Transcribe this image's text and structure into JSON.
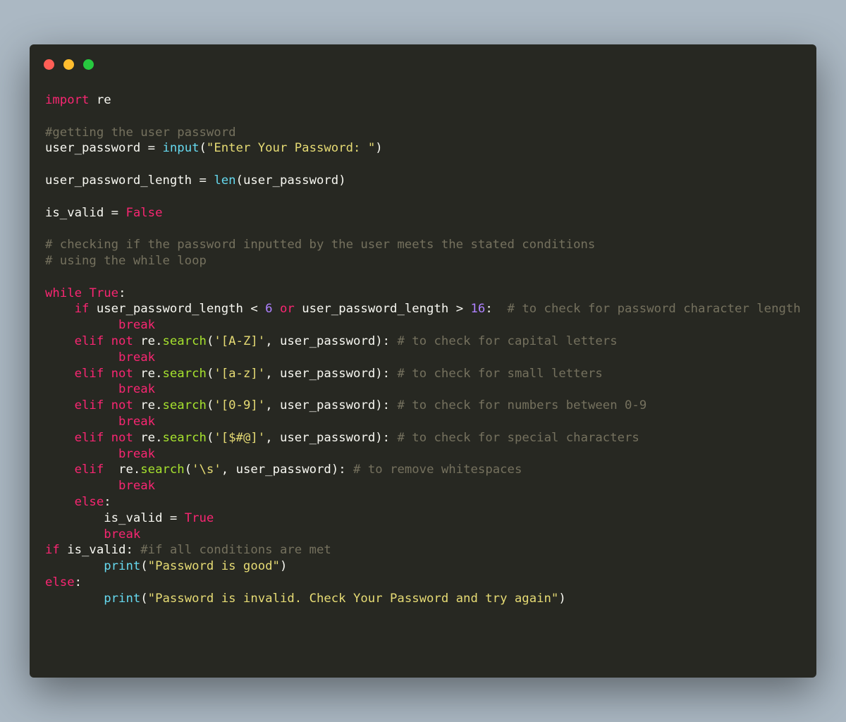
{
  "window": {
    "controls": [
      "close",
      "minimize",
      "maximize"
    ]
  },
  "colors": {
    "background": "#abb8c3",
    "editor": "#272822",
    "keyword": "#f92672",
    "builtin": "#66d9ef",
    "method": "#a6e22e",
    "string": "#e6db74",
    "number": "#ae81ff",
    "comment": "#75715e",
    "text": "#f8f8f2"
  },
  "code": {
    "lines": [
      [
        [
          "kw",
          "import"
        ],
        [
          "ws",
          " "
        ],
        [
          "id",
          "re"
        ]
      ],
      [],
      [
        [
          "cm",
          "#getting the user password"
        ]
      ],
      [
        [
          "id",
          "user_password"
        ],
        [
          "ws",
          " "
        ],
        [
          "op",
          "="
        ],
        [
          "ws",
          " "
        ],
        [
          "fn",
          "input"
        ],
        [
          "op",
          "("
        ],
        [
          "str",
          "\"Enter Your Password: \""
        ],
        [
          "op",
          ")"
        ]
      ],
      [],
      [
        [
          "id",
          "user_password_length"
        ],
        [
          "ws",
          " "
        ],
        [
          "op",
          "="
        ],
        [
          "ws",
          " "
        ],
        [
          "fn",
          "len"
        ],
        [
          "op",
          "("
        ],
        [
          "id",
          "user_password"
        ],
        [
          "op",
          ")"
        ]
      ],
      [],
      [
        [
          "id",
          "is_valid"
        ],
        [
          "ws",
          " "
        ],
        [
          "op",
          "="
        ],
        [
          "ws",
          " "
        ],
        [
          "kw",
          "False"
        ]
      ],
      [],
      [
        [
          "cm",
          "# checking if the password inputted by the user meets the stated conditions"
        ]
      ],
      [
        [
          "cm",
          "# using the while loop"
        ]
      ],
      [],
      [
        [
          "kw",
          "while"
        ],
        [
          "ws",
          " "
        ],
        [
          "kw",
          "True"
        ],
        [
          "op",
          ":"
        ]
      ],
      [
        [
          "ws",
          "    "
        ],
        [
          "kw",
          "if"
        ],
        [
          "ws",
          " "
        ],
        [
          "id",
          "user_password_length"
        ],
        [
          "ws",
          " "
        ],
        [
          "op",
          "<"
        ],
        [
          "ws",
          " "
        ],
        [
          "num",
          "6"
        ],
        [
          "ws",
          " "
        ],
        [
          "kw",
          "or"
        ],
        [
          "ws",
          " "
        ],
        [
          "id",
          "user_password_length"
        ],
        [
          "ws",
          " "
        ],
        [
          "op",
          ">"
        ],
        [
          "ws",
          " "
        ],
        [
          "num",
          "16"
        ],
        [
          "op",
          ":"
        ],
        [
          "ws",
          "  "
        ],
        [
          "cm",
          "# to check for password character length"
        ]
      ],
      [
        [
          "ws",
          "          "
        ],
        [
          "kw",
          "break"
        ]
      ],
      [
        [
          "ws",
          "    "
        ],
        [
          "kw",
          "elif"
        ],
        [
          "ws",
          " "
        ],
        [
          "kw",
          "not"
        ],
        [
          "ws",
          " "
        ],
        [
          "id",
          "re"
        ],
        [
          "op",
          "."
        ],
        [
          "meth",
          "search"
        ],
        [
          "op",
          "("
        ],
        [
          "str",
          "'[A-Z]'"
        ],
        [
          "op",
          ","
        ],
        [
          "ws",
          " "
        ],
        [
          "id",
          "user_password"
        ],
        [
          "op",
          "):"
        ],
        [
          "ws",
          " "
        ],
        [
          "cm",
          "# to check for capital letters"
        ]
      ],
      [
        [
          "ws",
          "          "
        ],
        [
          "kw",
          "break"
        ]
      ],
      [
        [
          "ws",
          "    "
        ],
        [
          "kw",
          "elif"
        ],
        [
          "ws",
          " "
        ],
        [
          "kw",
          "not"
        ],
        [
          "ws",
          " "
        ],
        [
          "id",
          "re"
        ],
        [
          "op",
          "."
        ],
        [
          "meth",
          "search"
        ],
        [
          "op",
          "("
        ],
        [
          "str",
          "'[a-z]'"
        ],
        [
          "op",
          ","
        ],
        [
          "ws",
          " "
        ],
        [
          "id",
          "user_password"
        ],
        [
          "op",
          "):"
        ],
        [
          "ws",
          " "
        ],
        [
          "cm",
          "# to check for small letters"
        ]
      ],
      [
        [
          "ws",
          "          "
        ],
        [
          "kw",
          "break"
        ]
      ],
      [
        [
          "ws",
          "    "
        ],
        [
          "kw",
          "elif"
        ],
        [
          "ws",
          " "
        ],
        [
          "kw",
          "not"
        ],
        [
          "ws",
          " "
        ],
        [
          "id",
          "re"
        ],
        [
          "op",
          "."
        ],
        [
          "meth",
          "search"
        ],
        [
          "op",
          "("
        ],
        [
          "str",
          "'[0-9]'"
        ],
        [
          "op",
          ","
        ],
        [
          "ws",
          " "
        ],
        [
          "id",
          "user_password"
        ],
        [
          "op",
          "):"
        ],
        [
          "ws",
          " "
        ],
        [
          "cm",
          "# to check for numbers between 0-9"
        ]
      ],
      [
        [
          "ws",
          "          "
        ],
        [
          "kw",
          "break"
        ]
      ],
      [
        [
          "ws",
          "    "
        ],
        [
          "kw",
          "elif"
        ],
        [
          "ws",
          " "
        ],
        [
          "kw",
          "not"
        ],
        [
          "ws",
          " "
        ],
        [
          "id",
          "re"
        ],
        [
          "op",
          "."
        ],
        [
          "meth",
          "search"
        ],
        [
          "op",
          "("
        ],
        [
          "str",
          "'[$#@]'"
        ],
        [
          "op",
          ","
        ],
        [
          "ws",
          " "
        ],
        [
          "id",
          "user_password"
        ],
        [
          "op",
          "):"
        ],
        [
          "ws",
          " "
        ],
        [
          "cm",
          "# to check for special characters"
        ]
      ],
      [
        [
          "ws",
          "          "
        ],
        [
          "kw",
          "break"
        ]
      ],
      [
        [
          "ws",
          "    "
        ],
        [
          "kw",
          "elif"
        ],
        [
          "ws",
          "  "
        ],
        [
          "id",
          "re"
        ],
        [
          "op",
          "."
        ],
        [
          "meth",
          "search"
        ],
        [
          "op",
          "("
        ],
        [
          "str",
          "'\\s'"
        ],
        [
          "op",
          ","
        ],
        [
          "ws",
          " "
        ],
        [
          "id",
          "user_password"
        ],
        [
          "op",
          "):"
        ],
        [
          "ws",
          " "
        ],
        [
          "cm",
          "# to remove whitespaces"
        ]
      ],
      [
        [
          "ws",
          "          "
        ],
        [
          "kw",
          "break"
        ]
      ],
      [
        [
          "ws",
          "    "
        ],
        [
          "kw",
          "else"
        ],
        [
          "op",
          ":"
        ]
      ],
      [
        [
          "ws",
          "        "
        ],
        [
          "id",
          "is_valid"
        ],
        [
          "ws",
          " "
        ],
        [
          "op",
          "="
        ],
        [
          "ws",
          " "
        ],
        [
          "kw",
          "True"
        ]
      ],
      [
        [
          "ws",
          "        "
        ],
        [
          "kw",
          "break"
        ]
      ],
      [
        [
          "kw",
          "if"
        ],
        [
          "ws",
          " "
        ],
        [
          "id",
          "is_valid"
        ],
        [
          "op",
          ":"
        ],
        [
          "ws",
          " "
        ],
        [
          "cm",
          "#if all conditions are met"
        ]
      ],
      [
        [
          "ws",
          "        "
        ],
        [
          "fn",
          "print"
        ],
        [
          "op",
          "("
        ],
        [
          "str",
          "\"Password is good\""
        ],
        [
          "op",
          ")"
        ]
      ],
      [
        [
          "kw",
          "else"
        ],
        [
          "op",
          ":"
        ]
      ],
      [
        [
          "ws",
          "        "
        ],
        [
          "fn",
          "print"
        ],
        [
          "op",
          "("
        ],
        [
          "str",
          "\"Password is invalid. Check Your Password and try again\""
        ],
        [
          "op",
          ")"
        ]
      ]
    ]
  }
}
